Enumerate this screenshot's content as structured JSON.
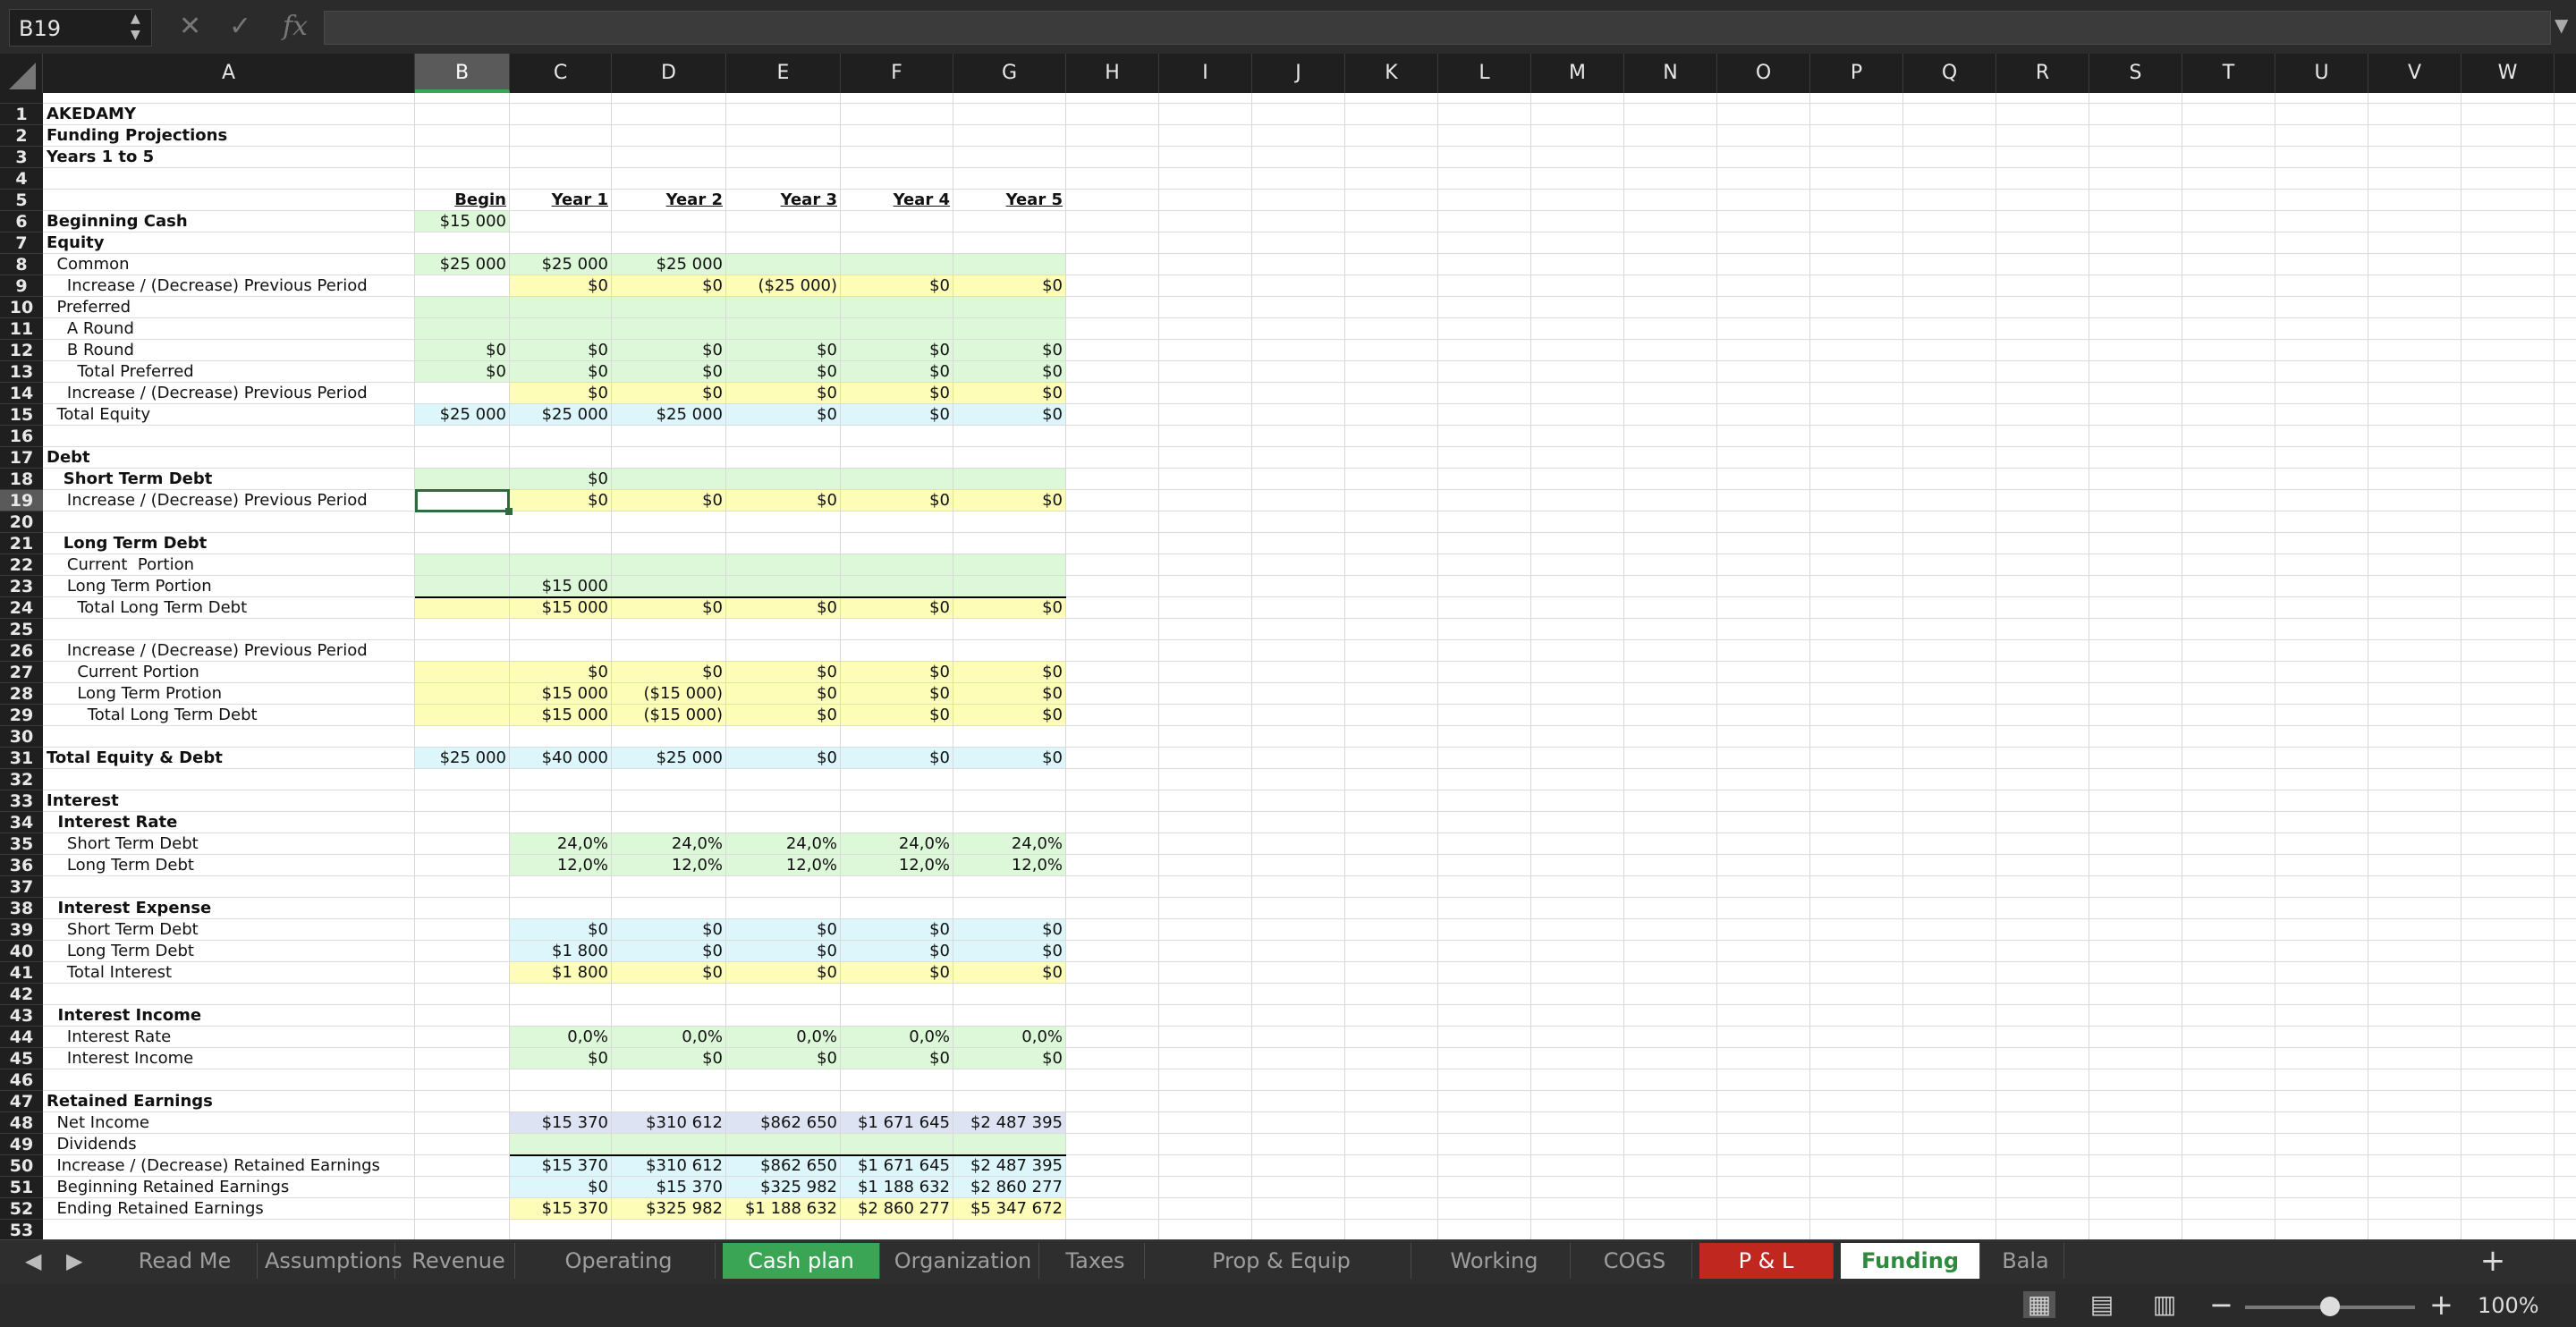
{
  "formula_bar": {
    "name_box": "B19",
    "cancel_icon": "✕",
    "confirm_icon": "✓",
    "fx_label": "fx",
    "value": ""
  },
  "columns": [
    "A",
    "B",
    "C",
    "D",
    "E",
    "F",
    "G",
    "H",
    "I",
    "J",
    "K",
    "L",
    "M",
    "N",
    "O",
    "P",
    "Q",
    "R",
    "S",
    "T",
    "U",
    "V",
    "W"
  ],
  "selected_cell": "B19",
  "colors": {
    "green_fill": "#ddf7d9",
    "yellow_fill": "#fdfdb8",
    "cyan_fill": "#dcf6fb",
    "lavender_fill": "#dde3f2",
    "tab_green": "#3aa655",
    "tab_red": "#c0271e",
    "header_bg": "#1f1f1f"
  },
  "fills": [
    {
      "cols": "B",
      "rows": [
        6,
        6
      ],
      "c": "green"
    },
    {
      "cols": "B",
      "rows": [
        8,
        8
      ],
      "c": "green"
    },
    {
      "cols": "C-G",
      "rows": [
        8,
        8
      ],
      "c": "green"
    },
    {
      "cols": "C-G",
      "rows": [
        9,
        9
      ],
      "c": "yellow"
    },
    {
      "cols": "B-G",
      "rows": [
        10,
        13
      ],
      "c": "green"
    },
    {
      "cols": "C-G",
      "rows": [
        14,
        14
      ],
      "c": "yellow"
    },
    {
      "cols": "B-G",
      "rows": [
        15,
        15
      ],
      "c": "cyan"
    },
    {
      "cols": "B-G",
      "rows": [
        18,
        18
      ],
      "c": "green"
    },
    {
      "cols": "C-G",
      "rows": [
        19,
        19
      ],
      "c": "yellow"
    },
    {
      "cols": "B-G",
      "rows": [
        22,
        23
      ],
      "c": "green"
    },
    {
      "cols": "B-G",
      "rows": [
        24,
        24
      ],
      "c": "yellow"
    },
    {
      "cols": "B-G",
      "rows": [
        27,
        29
      ],
      "c": "yellow"
    },
    {
      "cols": "B-G",
      "rows": [
        31,
        31
      ],
      "c": "cyan"
    },
    {
      "cols": "C-G",
      "rows": [
        35,
        36
      ],
      "c": "green"
    },
    {
      "cols": "C-G",
      "rows": [
        39,
        40
      ],
      "c": "cyan"
    },
    {
      "cols": "C-G",
      "rows": [
        41,
        41
      ],
      "c": "yellow"
    },
    {
      "cols": "C-G",
      "rows": [
        44,
        45
      ],
      "c": "green"
    },
    {
      "cols": "C-G",
      "rows": [
        48,
        48
      ],
      "c": "lavender"
    },
    {
      "cols": "C-G",
      "rows": [
        49,
        49
      ],
      "c": "green"
    },
    {
      "cols": "C-G",
      "rows": [
        50,
        51
      ],
      "c": "cyan"
    },
    {
      "cols": "C-G",
      "rows": [
        52,
        52
      ],
      "c": "yellow"
    }
  ],
  "rows": [
    {
      "n": 1,
      "a": "AKEDAMY",
      "b": true
    },
    {
      "n": 2,
      "a": "Funding Projections",
      "b": true
    },
    {
      "n": 3,
      "a": "Years 1 to 5",
      "b": true
    },
    {
      "n": 4
    },
    {
      "n": 5,
      "hdr": true,
      "v": [
        "Begin",
        "Year 1",
        "Year 2",
        "Year 3",
        "Year 4",
        "Year 5"
      ]
    },
    {
      "n": 6,
      "a": "Beginning Cash",
      "b": true,
      "v": [
        "$15 000"
      ]
    },
    {
      "n": 7,
      "a": "Equity",
      "b": true
    },
    {
      "n": 8,
      "a": "  Common",
      "v": [
        "$25 000",
        "$25 000",
        "$25 000"
      ]
    },
    {
      "n": 9,
      "a": "    Increase / (Decrease) Previous Period",
      "v": [
        "",
        "$0",
        "$0",
        "($25 000)",
        "$0",
        "$0"
      ]
    },
    {
      "n": 10,
      "a": "  Preferred"
    },
    {
      "n": 11,
      "a": "    A Round"
    },
    {
      "n": 12,
      "a": "    B Round",
      "v": [
        "$0",
        "$0",
        "$0",
        "$0",
        "$0",
        "$0"
      ]
    },
    {
      "n": 13,
      "a": "      Total Preferred",
      "v": [
        "$0",
        "$0",
        "$0",
        "$0",
        "$0",
        "$0"
      ]
    },
    {
      "n": 14,
      "a": "    Increase / (Decrease) Previous Period",
      "v": [
        "",
        "$0",
        "$0",
        "$0",
        "$0",
        "$0"
      ]
    },
    {
      "n": 15,
      "a": "  Total Equity",
      "v": [
        "$25 000",
        "$25 000",
        "$25 000",
        "$0",
        "$0",
        "$0"
      ]
    },
    {
      "n": 16
    },
    {
      "n": 17,
      "a": "Debt",
      "b": true
    },
    {
      "n": 18,
      "a": "   Short Term Debt",
      "b": true,
      "v": [
        "",
        "$0"
      ]
    },
    {
      "n": 19,
      "a": "    Increase / (Decrease) Previous Period",
      "v": [
        "",
        "$0",
        "$0",
        "$0",
        "$0",
        "$0"
      ]
    },
    {
      "n": 20
    },
    {
      "n": 21,
      "a": "   Long Term Debt",
      "b": true
    },
    {
      "n": 22,
      "a": "    Current  Portion"
    },
    {
      "n": 23,
      "a": "    Long Term Portion",
      "v": [
        "",
        "$15 000"
      ]
    },
    {
      "n": 24,
      "a": "      Total Long Term Debt",
      "v": [
        "",
        "$15 000",
        "$0",
        "$0",
        "$0",
        "$0"
      ]
    },
    {
      "n": 25
    },
    {
      "n": 26,
      "a": "    Increase / (Decrease) Previous Period"
    },
    {
      "n": 27,
      "a": "      Current Portion",
      "v": [
        "",
        "$0",
        "$0",
        "$0",
        "$0",
        "$0"
      ]
    },
    {
      "n": 28,
      "a": "      Long Term Protion",
      "v": [
        "",
        "$15 000",
        "($15 000)",
        "$0",
        "$0",
        "$0"
      ]
    },
    {
      "n": 29,
      "a": "        Total Long Term Debt",
      "v": [
        "",
        "$15 000",
        "($15 000)",
        "$0",
        "$0",
        "$0"
      ]
    },
    {
      "n": 30
    },
    {
      "n": 31,
      "a": "Total Equity & Debt",
      "b": true,
      "v": [
        "$25 000",
        "$40 000",
        "$25 000",
        "$0",
        "$0",
        "$0"
      ]
    },
    {
      "n": 32
    },
    {
      "n": 33,
      "a": "Interest",
      "b": true
    },
    {
      "n": 34,
      "a": "  Interest Rate",
      "b": true
    },
    {
      "n": 35,
      "a": "    Short Term Debt",
      "v": [
        "",
        "24,0%",
        "24,0%",
        "24,0%",
        "24,0%",
        "24,0%"
      ]
    },
    {
      "n": 36,
      "a": "    Long Term Debt",
      "v": [
        "",
        "12,0%",
        "12,0%",
        "12,0%",
        "12,0%",
        "12,0%"
      ]
    },
    {
      "n": 37
    },
    {
      "n": 38,
      "a": "  Interest Expense",
      "b": true
    },
    {
      "n": 39,
      "a": "    Short Term Debt",
      "v": [
        "",
        "$0",
        "$0",
        "$0",
        "$0",
        "$0"
      ]
    },
    {
      "n": 40,
      "a": "    Long Term Debt",
      "v": [
        "",
        "$1 800",
        "$0",
        "$0",
        "$0",
        "$0"
      ]
    },
    {
      "n": 41,
      "a": "    Total Interest",
      "v": [
        "",
        "$1 800",
        "$0",
        "$0",
        "$0",
        "$0"
      ]
    },
    {
      "n": 42
    },
    {
      "n": 43,
      "a": "  Interest Income",
      "b": true
    },
    {
      "n": 44,
      "a": "    Interest Rate",
      "v": [
        "",
        "0,0%",
        "0,0%",
        "0,0%",
        "0,0%",
        "0,0%"
      ]
    },
    {
      "n": 45,
      "a": "    Interest Income",
      "v": [
        "",
        "$0",
        "$0",
        "$0",
        "$0",
        "$0"
      ]
    },
    {
      "n": 46
    },
    {
      "n": 47,
      "a": "Retained Earnings",
      "b": true
    },
    {
      "n": 48,
      "a": "  Net Income",
      "v": [
        "",
        "$15 370",
        "$310 612",
        "$862 650",
        "$1 671 645",
        "$2 487 395"
      ]
    },
    {
      "n": 49,
      "a": "  Dividends"
    },
    {
      "n": 50,
      "a": "  Increase / (Decrease) Retained Earnings",
      "v": [
        "",
        "$15 370",
        "$310 612",
        "$862 650",
        "$1 671 645",
        "$2 487 395"
      ]
    },
    {
      "n": 51,
      "a": "  Beginning Retained Earnings",
      "v": [
        "",
        "$0",
        "$15 370",
        "$325 982",
        "$1 188 632",
        "$2 860 277"
      ]
    },
    {
      "n": 52,
      "a": "  Ending Retained Earnings",
      "v": [
        "",
        "$15 370",
        "$325 982",
        "$1 188 632",
        "$2 860 277",
        "$5 347 672"
      ]
    },
    {
      "n": 53
    }
  ],
  "tabs": [
    {
      "label": "Read Me",
      "style": ""
    },
    {
      "label": "Assumptions",
      "style": ""
    },
    {
      "label": "Revenue",
      "style": ""
    },
    {
      "label": "Operating Expenses",
      "style": ""
    },
    {
      "label": "Cash plan",
      "style": "green"
    },
    {
      "label": "Organization",
      "style": ""
    },
    {
      "label": "Taxes",
      "style": ""
    },
    {
      "label": "Prop & Equip Depreciation",
      "style": ""
    },
    {
      "label": "Working Capital",
      "style": ""
    },
    {
      "label": "COGS",
      "style": ""
    },
    {
      "label": "P & L",
      "style": "red"
    },
    {
      "label": "Funding",
      "style": "active"
    },
    {
      "label": "Bala",
      "style": ""
    }
  ],
  "status": {
    "zoom": "100%"
  }
}
